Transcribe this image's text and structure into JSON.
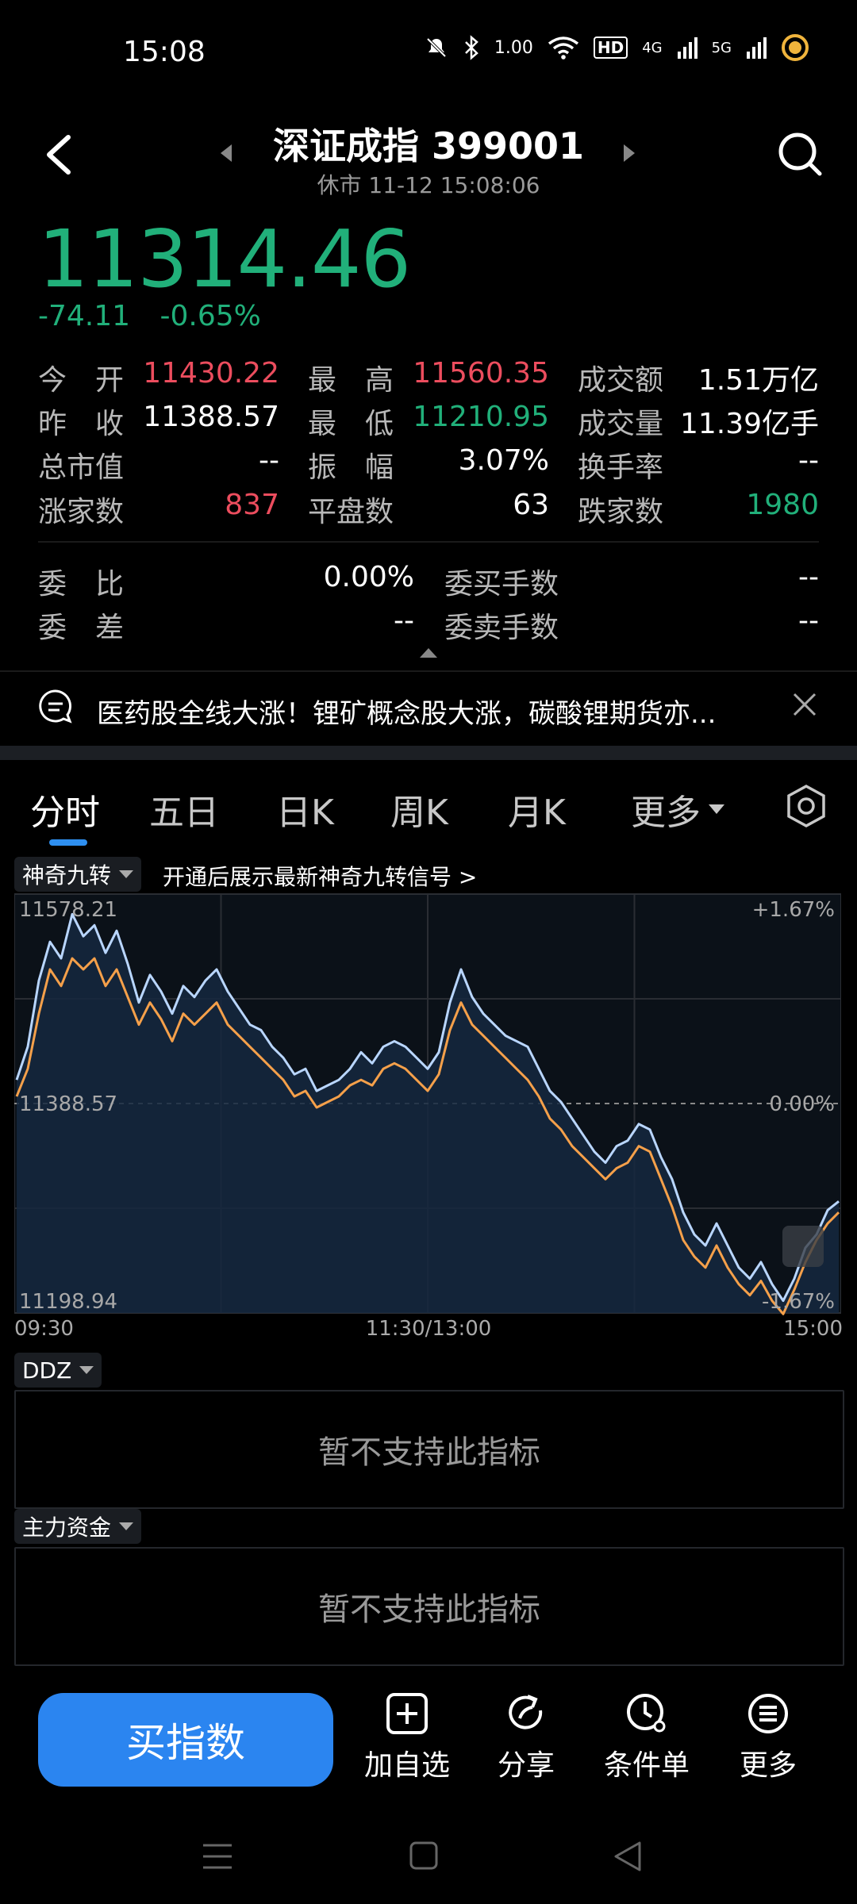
{
  "status_bar": {
    "time": "15:08",
    "network_speed": "1.00",
    "hd_label": "HD",
    "net1": "4G",
    "net2": "5G",
    "icons": [
      "mute-icon",
      "bluetooth-icon",
      "wifi-icon",
      "signal-icon",
      "signal-icon",
      "battery-icon"
    ]
  },
  "header": {
    "title": "深证成指 399001",
    "subtitle": "休市 11-12 15:08:06"
  },
  "quote": {
    "price": "11314.46",
    "change": "-74.11",
    "change_pct": "-0.65%"
  },
  "stats": {
    "open_label": "今　开",
    "open": "11430.22",
    "high_label": "最　高",
    "high": "11560.35",
    "amount_label": "成交额",
    "amount": "1.51万亿",
    "prev_close_label": "昨　收",
    "prev_close": "11388.57",
    "low_label": "最　低",
    "low": "11210.95",
    "volume_label": "成交量",
    "volume": "11.39亿手",
    "mktcap_label": "总市值",
    "mktcap": "--",
    "amplitude_label": "振　幅",
    "amplitude": "3.07%",
    "turnover_label": "换手率",
    "turnover": "--",
    "up_label": "涨家数",
    "up": "837",
    "flat_label": "平盘数",
    "flat": "63",
    "down_label": "跌家数",
    "down": "1980",
    "ratio_label": "委　比",
    "ratio": "0.00%",
    "bid_label": "委买手数",
    "bid": "--",
    "diff_label": "委　差",
    "diff": "--",
    "ask_label": "委卖手数",
    "ask": "--"
  },
  "news": {
    "text": "医药股全线大涨！锂矿概念股大涨，碳酸锂期货亦..."
  },
  "tabs": [
    "分时",
    "五日",
    "日K",
    "周K",
    "月K",
    "更多"
  ],
  "indicator": {
    "chip": "神奇九转",
    "promo": "开通后展示最新神奇九转信号 >"
  },
  "chart_data": {
    "type": "line",
    "y_top_label": "11578.21",
    "y_mid_label": "11388.57",
    "y_bottom_label": "11198.94",
    "pct_top_label": "+1.67%",
    "pct_mid_label": "0.00%",
    "pct_bottom_label": "-1.67%",
    "x_labels": [
      "09:30",
      "11:30/13:00",
      "15:00"
    ],
    "ylim": [
      11198.94,
      11578.21
    ],
    "series": [
      {
        "color": "#b9d6ff",
        "values": [
          11410,
          11440,
          11500,
          11535,
          11520,
          11560,
          11540,
          11550,
          11525,
          11545,
          11515,
          11480,
          11505,
          11490,
          11470,
          11495,
          11485,
          11500,
          11510,
          11490,
          11475,
          11460,
          11455,
          11440,
          11430,
          11415,
          11420,
          11400,
          11405,
          11410,
          11420,
          11435,
          11425,
          11440,
          11445,
          11440,
          11430,
          11420,
          11435,
          11480,
          11510,
          11485,
          11470,
          11460,
          11450,
          11445,
          11440,
          11420,
          11400,
          11390,
          11375,
          11360,
          11345,
          11335,
          11350,
          11355,
          11370,
          11365,
          11340,
          11320,
          11290,
          11270,
          11260,
          11280,
          11260,
          11240,
          11230,
          11245,
          11225,
          11210,
          11230,
          11258,
          11270,
          11292,
          11300
        ]
      },
      {
        "color": "#f5a04a",
        "values": [
          11395,
          11420,
          11470,
          11510,
          11495,
          11520,
          11510,
          11520,
          11495,
          11510,
          11485,
          11460,
          11480,
          11465,
          11445,
          11470,
          11460,
          11470,
          11480,
          11460,
          11450,
          11440,
          11430,
          11420,
          11410,
          11395,
          11400,
          11385,
          11390,
          11395,
          11405,
          11410,
          11405,
          11420,
          11425,
          11420,
          11410,
          11400,
          11415,
          11455,
          11480,
          11460,
          11450,
          11440,
          11430,
          11420,
          11410,
          11395,
          11375,
          11365,
          11350,
          11340,
          11330,
          11320,
          11330,
          11335,
          11350,
          11345,
          11320,
          11295,
          11265,
          11250,
          11240,
          11260,
          11240,
          11225,
          11215,
          11228,
          11210,
          11198,
          11220,
          11245,
          11265,
          11280,
          11290
        ]
      }
    ]
  },
  "ddz": {
    "chip": "DDZ",
    "message": "暂不支持此指标"
  },
  "fund": {
    "chip": "主力资金",
    "message": "暂不支持此指标"
  },
  "actions": {
    "buy": "买指数",
    "add": "加自选",
    "share": "分享",
    "condition": "条件单",
    "more": "更多"
  }
}
